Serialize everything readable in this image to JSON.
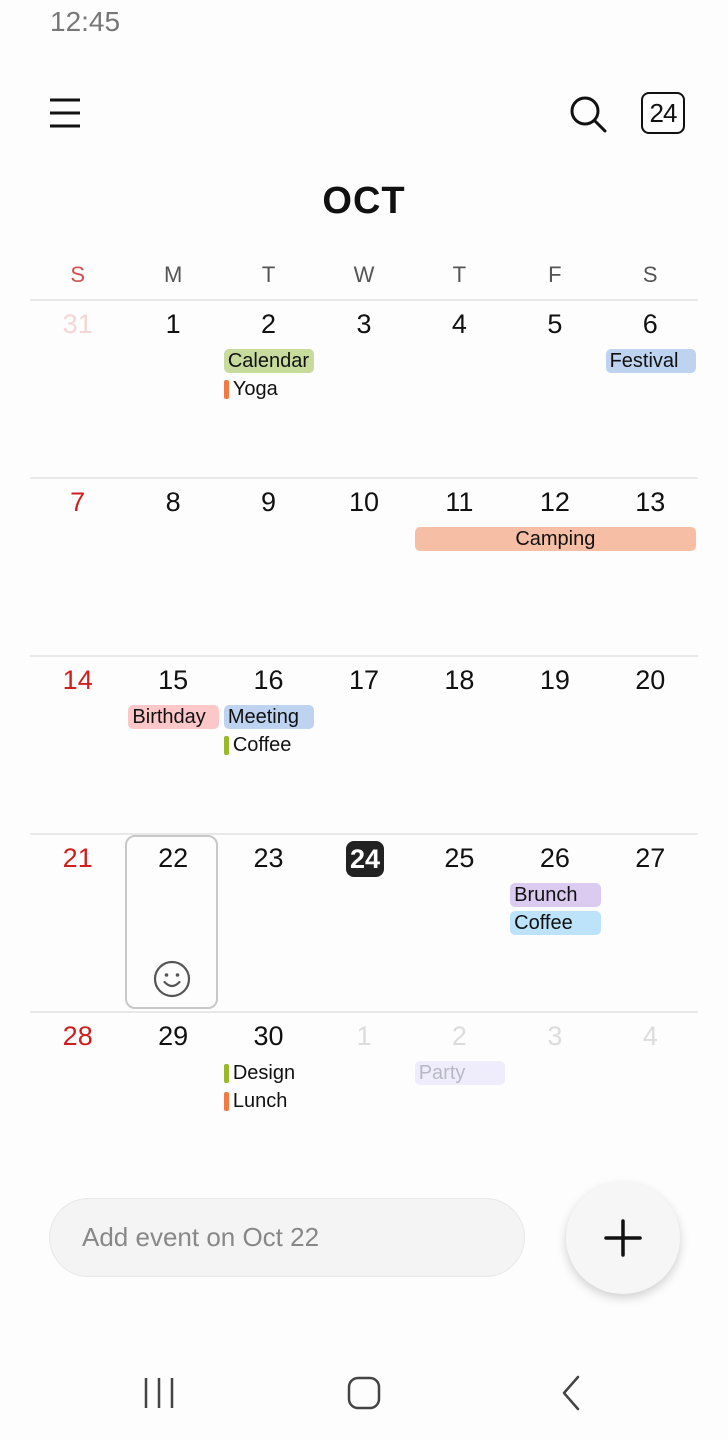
{
  "status_bar": {
    "time": "12:45"
  },
  "header": {
    "menu_icon": "hamburger-menu-icon",
    "search_icon": "search-icon",
    "today_button_label": "24",
    "month_title": "OCT"
  },
  "weekdays": [
    "S",
    "M",
    "T",
    "W",
    "T",
    "F",
    "S"
  ],
  "colors": {
    "sunday": "#d01e1e",
    "today_bg": "#222222",
    "green": "#c7db9c",
    "blue": "#bdd3f0",
    "salmon": "#f7bea6",
    "pink": "#fbc7c9",
    "purple": "#dccbf1",
    "lightblue": "#bde3fb",
    "lavender": "#efedfb",
    "orange_bar": "#f07a45",
    "green_bar": "#97b92b"
  },
  "weeks": [
    {
      "days": [
        {
          "num": "31",
          "muted": true
        },
        {
          "num": "1"
        },
        {
          "num": "2"
        },
        {
          "num": "3"
        },
        {
          "num": "4"
        },
        {
          "num": "5"
        },
        {
          "num": "6"
        }
      ],
      "events": [
        {
          "label": "Calendar",
          "type": "chip",
          "start": 2,
          "span": 1,
          "row": 0,
          "color": "#c7db9c"
        },
        {
          "label": "Yoga",
          "type": "bar",
          "start": 2,
          "row": 1,
          "color": "#f07a45"
        },
        {
          "label": "Festival",
          "type": "chip",
          "start": 6,
          "span": 1,
          "row": 0,
          "color": "#bdd3f0"
        }
      ]
    },
    {
      "days": [
        {
          "num": "7"
        },
        {
          "num": "8"
        },
        {
          "num": "9"
        },
        {
          "num": "10"
        },
        {
          "num": "11"
        },
        {
          "num": "12"
        },
        {
          "num": "13"
        }
      ],
      "events": [
        {
          "label": "Camping",
          "type": "chip",
          "start": 4,
          "span": 3,
          "row": 0,
          "color": "#f7bea6",
          "center": true
        }
      ]
    },
    {
      "days": [
        {
          "num": "14"
        },
        {
          "num": "15"
        },
        {
          "num": "16"
        },
        {
          "num": "17"
        },
        {
          "num": "18"
        },
        {
          "num": "19"
        },
        {
          "num": "20"
        }
      ],
      "events": [
        {
          "label": "Birthday",
          "type": "chip",
          "start": 1,
          "span": 1,
          "row": 0,
          "color": "#fbc7c9"
        },
        {
          "label": "Meeting",
          "type": "chip",
          "start": 2,
          "span": 1,
          "row": 0,
          "color": "#bdd3f0"
        },
        {
          "label": "Coffee",
          "type": "bar",
          "start": 2,
          "row": 1,
          "color": "#97b92b"
        }
      ]
    },
    {
      "days": [
        {
          "num": "21"
        },
        {
          "num": "22",
          "selected": true
        },
        {
          "num": "23"
        },
        {
          "num": "24",
          "today": true
        },
        {
          "num": "25"
        },
        {
          "num": "26"
        },
        {
          "num": "27"
        }
      ],
      "events": [
        {
          "label": "Brunch",
          "type": "chip",
          "start": 5,
          "span": 1,
          "row": 0,
          "color": "#dccbf1"
        },
        {
          "label": "Coffee",
          "type": "chip",
          "start": 5,
          "span": 1,
          "row": 1,
          "color": "#bde3fb"
        }
      ]
    },
    {
      "days": [
        {
          "num": "28"
        },
        {
          "num": "29"
        },
        {
          "num": "30"
        },
        {
          "num": "1",
          "muted": true
        },
        {
          "num": "2",
          "muted": true
        },
        {
          "num": "3",
          "muted": true
        },
        {
          "num": "4",
          "muted": true
        }
      ],
      "events": [
        {
          "label": "Design",
          "type": "bar",
          "start": 2,
          "row": 0,
          "color": "#97b92b"
        },
        {
          "label": "Lunch",
          "type": "bar",
          "start": 2,
          "row": 1,
          "color": "#f07a45"
        },
        {
          "label": "Party",
          "type": "chip",
          "start": 4,
          "span": 1,
          "row": 0,
          "color": "#efedfb",
          "muted": true
        }
      ]
    }
  ],
  "selected_day_icon": "smiley-face-icon",
  "add_event": {
    "placeholder": "Add event on Oct 22"
  },
  "fab_icon": "plus-icon",
  "nav_bar": {
    "recents_icon": "recent-apps-icon",
    "home_icon": "home-icon",
    "back_icon": "back-icon"
  }
}
